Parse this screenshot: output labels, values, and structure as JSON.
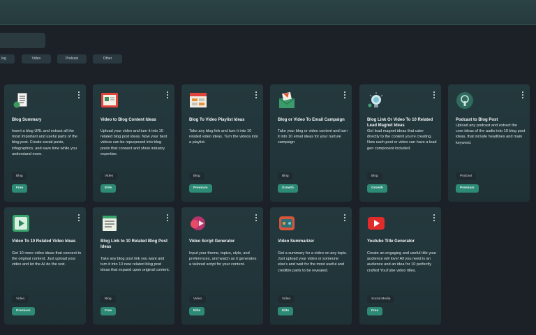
{
  "filters": [
    "log",
    "Video",
    "Podcast",
    "Other"
  ],
  "cards": [
    {
      "title": "Blog Summary",
      "desc": "Insert a blog URL and extract all the most important and useful parts of the blog post.  Create social posts, infographics, and save time while you understand more.",
      "category": "Blog",
      "tier": "Free",
      "icon": "document-icon"
    },
    {
      "title": "Video to Blog Content Ideas",
      "desc": "Upload your video and turn it into 10 related blog post ideas. Now your best videos can be repurposed into blog posts that connect and show industry expertise.",
      "category": "Video",
      "tier": "Elite",
      "icon": "video-frame-icon"
    },
    {
      "title": "Blog To Video Playlist Ideas",
      "desc": "Take any blog link and turn it into 10 related video ideas.  Turn the videos into a playlist.",
      "category": "Blog",
      "tier": "Premium",
      "icon": "playlist-icon"
    },
    {
      "title": "Blog or Video To Email Campaign",
      "desc": "Take your blog or video content and turn it into 10 email ideas for your nurture campaign",
      "category": "Blog",
      "tier": "Growth",
      "icon": "email-icon"
    },
    {
      "title": "Blog Link Or Video To 10 Related Lead Magnet Ideas",
      "desc": "Get lead magnet ideas that cater directly to the content you're creating. Now each post or video can have a lead gen component included.",
      "category": "Blog",
      "tier": "Growth",
      "icon": "lightbulb-icon"
    },
    {
      "title": "Podcast to Blog Post",
      "desc": "Upload any podcast and extract the core ideas of the audio  into 10 blog post ideas, that include headlines and main keyword.",
      "category": "Podcast",
      "tier": "Premium",
      "icon": "podcast-icon"
    },
    {
      "title": "Video To 10 Related Video Ideas",
      "desc": "Get 10 more video ideas that connect to the original content. Just upload your video and let the AI do the rest.",
      "category": "Video",
      "tier": "Premium",
      "icon": "play-icon"
    },
    {
      "title": "Blog Link to 10 Related Blog Post Ideas",
      "desc": "Take any blog post link you want and turn it into 10 new related blog post ideas that expand upon original content.",
      "category": "Blog",
      "tier": "Free",
      "icon": "notes-icon"
    },
    {
      "title": "Video Script Generator",
      "desc": "Input your theme, topics, style, and preferences, and watch as it generates a tailored script for your content.",
      "category": "Video",
      "tier": "Elite",
      "icon": "script-play-icon"
    },
    {
      "title": "Video Summarizer",
      "desc": "Get a summary for a video on any topic. Just upload your video or someone else's and wait for the most useful and credible parts to be revealed.",
      "category": "Video",
      "tier": "Elite",
      "icon": "summarizer-icon"
    },
    {
      "title": "Youtube Title Generator",
      "desc": "Create an engaging and useful  title your audience will love! All you need is an audience and an idea for 10 perfectly crafted YouTube video titles.",
      "category": "Social Media",
      "tier": "Free",
      "icon": "youtube-icon"
    }
  ]
}
